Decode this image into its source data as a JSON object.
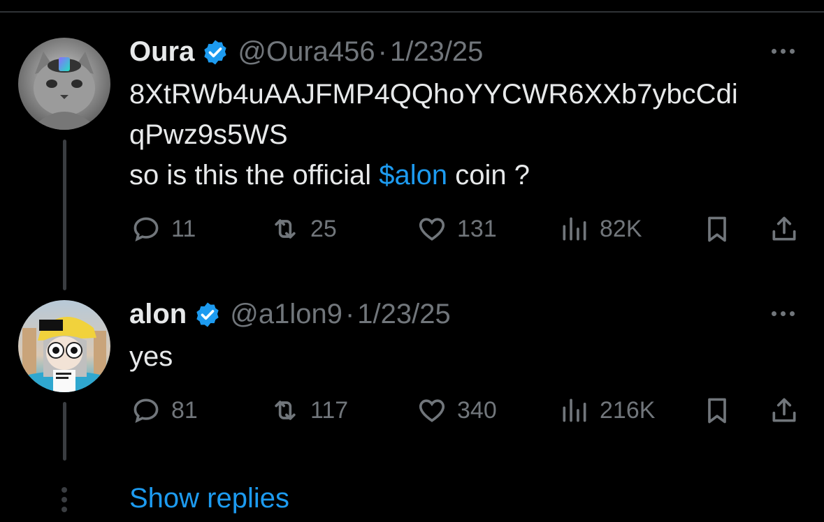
{
  "tweets": [
    {
      "name": "Oura",
      "handle": "@Oura456",
      "separator": "·",
      "date": "1/23/25",
      "lines": [
        "8XtRWb4uAAJFMP4QQhoYYCWR6XXb7ybcCdi",
        "qPwz9s5WS"
      ],
      "body_prefix": "so is this the official ",
      "body_mention": "$alon",
      "body_suffix": " coin ?",
      "replies": "11",
      "reposts": "25",
      "likes": "131",
      "views": "82K"
    },
    {
      "name": "alon",
      "handle": "@a1lon9",
      "separator": "·",
      "date": "1/23/25",
      "body": "yes",
      "replies": "81",
      "reposts": "117",
      "likes": "340",
      "views": "216K"
    }
  ],
  "show_replies": "Show replies",
  "colors": {
    "background": "#000000",
    "text": "#e7e9ea",
    "muted": "#71767b",
    "accent": "#1d9bf0"
  },
  "icons": [
    "verified-badge-icon",
    "more-icon",
    "reply-icon",
    "repost-icon",
    "like-icon",
    "views-icon",
    "bookmark-icon",
    "share-icon"
  ]
}
